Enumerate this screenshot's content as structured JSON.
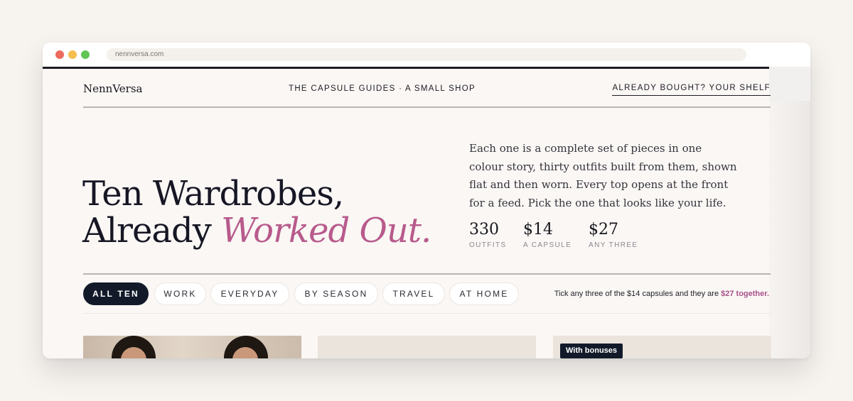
{
  "browser": {
    "url": "nennversa.com"
  },
  "nav": {
    "logo": "NennVersa",
    "tagline": "THE CAPSULE GUIDES · A SMALL SHOP",
    "shelf_link": "ALREADY BOUGHT? YOUR SHELF"
  },
  "hero": {
    "headline_line1": "Ten Wardrobes,",
    "headline_line2_plain": "Already ",
    "headline_line2_accent": "Worked Out.",
    "description": "Each one is a complete set of pieces in one colour story, thirty outfits built from them, shown flat and then worn. Every top opens at the front for a feed. Pick the one that looks like your life.",
    "stats": [
      {
        "value": "330",
        "label": "OUTFITS"
      },
      {
        "value": "$14",
        "label": "A CAPSULE"
      },
      {
        "value": "$27",
        "label": "ANY THREE"
      }
    ]
  },
  "filters": {
    "chips": [
      {
        "label": "ALL TEN",
        "active": true
      },
      {
        "label": "WORK",
        "active": false
      },
      {
        "label": "EVERYDAY",
        "active": false
      },
      {
        "label": "BY SEASON",
        "active": false
      },
      {
        "label": "TRAVEL",
        "active": false
      },
      {
        "label": "AT HOME",
        "active": false
      }
    ],
    "hint_text": "Tick any three of the $14 capsules and they are ",
    "hint_strong": "$27 together."
  },
  "cards": {
    "badge": "With bonuses"
  },
  "colors": {
    "accent": "#b85a8c",
    "navy": "#121a2a",
    "background": "#faf7f4"
  }
}
